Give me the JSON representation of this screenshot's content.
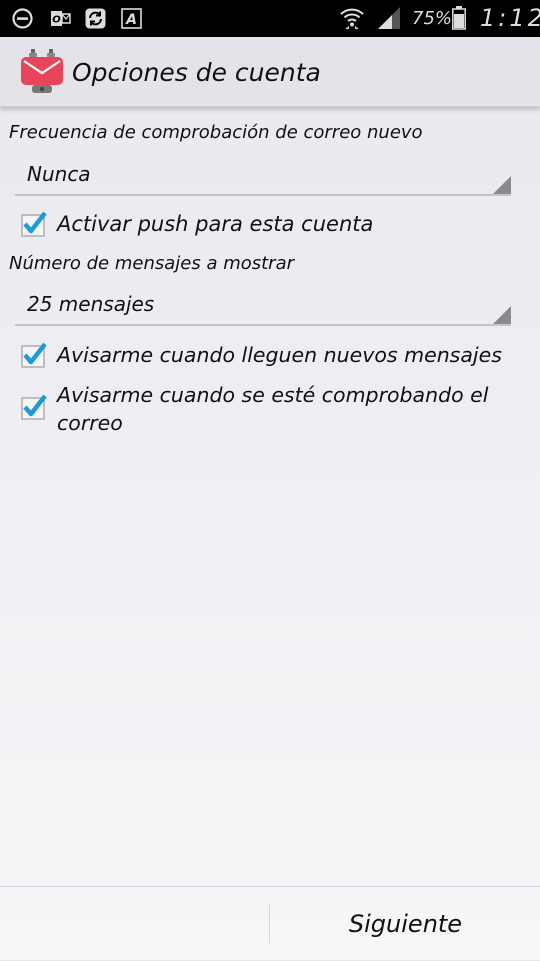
{
  "status_bar": {
    "battery_percent": "75%",
    "time": "1:12"
  },
  "header": {
    "title": "Opciones de cuenta"
  },
  "settings": {
    "check_frequency_label": "Frecuencia de comprobación de correo nuevo",
    "check_frequency_value": "Nunca",
    "push_label": "Activar push para esta cuenta",
    "push_checked": true,
    "message_count_label": "Número de mensajes a mostrar",
    "message_count_value": "25 mensajes",
    "notify_new_label": "Avisarme cuando lleguen nuevos mensajes",
    "notify_new_checked": true,
    "notify_checking_label": "Avisarme cuando se esté comprobando el correo",
    "notify_checking_checked": true
  },
  "footer": {
    "next_label": "Siguiente"
  },
  "colors": {
    "checkmark": "#1e9ad6",
    "app_icon": "#e8455a"
  }
}
